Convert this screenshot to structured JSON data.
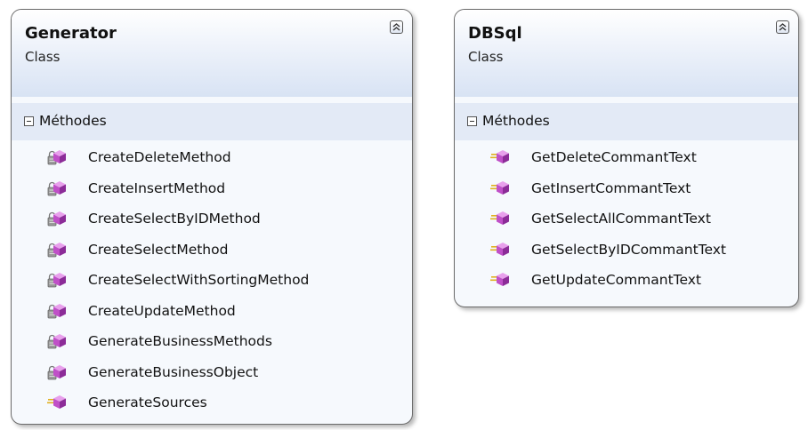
{
  "classes": [
    {
      "name": "Generator",
      "stereotype": "Class",
      "section": "Méthodes",
      "methods": [
        {
          "label": "CreateDeleteMethod",
          "icon": "private-method-icon"
        },
        {
          "label": "CreateInsertMethod",
          "icon": "private-method-icon"
        },
        {
          "label": "CreateSelectByIDMethod",
          "icon": "private-method-icon"
        },
        {
          "label": "CreateSelectMethod",
          "icon": "private-method-icon"
        },
        {
          "label": "CreateSelectWithSortingMethod",
          "icon": "private-method-icon"
        },
        {
          "label": "CreateUpdateMethod",
          "icon": "private-method-icon"
        },
        {
          "label": "GenerateBusinessMethods",
          "icon": "private-method-icon"
        },
        {
          "label": "GenerateBusinessObject",
          "icon": "private-method-icon"
        },
        {
          "label": "GenerateSources",
          "icon": "public-method-icon"
        }
      ]
    },
    {
      "name": "DBSql",
      "stereotype": "Class",
      "section": "Méthodes",
      "methods": [
        {
          "label": "GetDeleteCommantText",
          "icon": "public-method-icon"
        },
        {
          "label": "GetInsertCommantText",
          "icon": "public-method-icon"
        },
        {
          "label": "GetSelectAllCommantText",
          "icon": "public-method-icon"
        },
        {
          "label": "GetSelectByIDCommantText",
          "icon": "public-method-icon"
        },
        {
          "label": "GetUpdateCommantText",
          "icon": "public-method-icon"
        }
      ]
    }
  ],
  "colors": {
    "method_cube": "#c050c8",
    "lock": "#9a9a9a",
    "public_lines": "#e0b020",
    "header_gradient_end": "#d8e3f4",
    "section_bg": "#e3eaf6"
  }
}
